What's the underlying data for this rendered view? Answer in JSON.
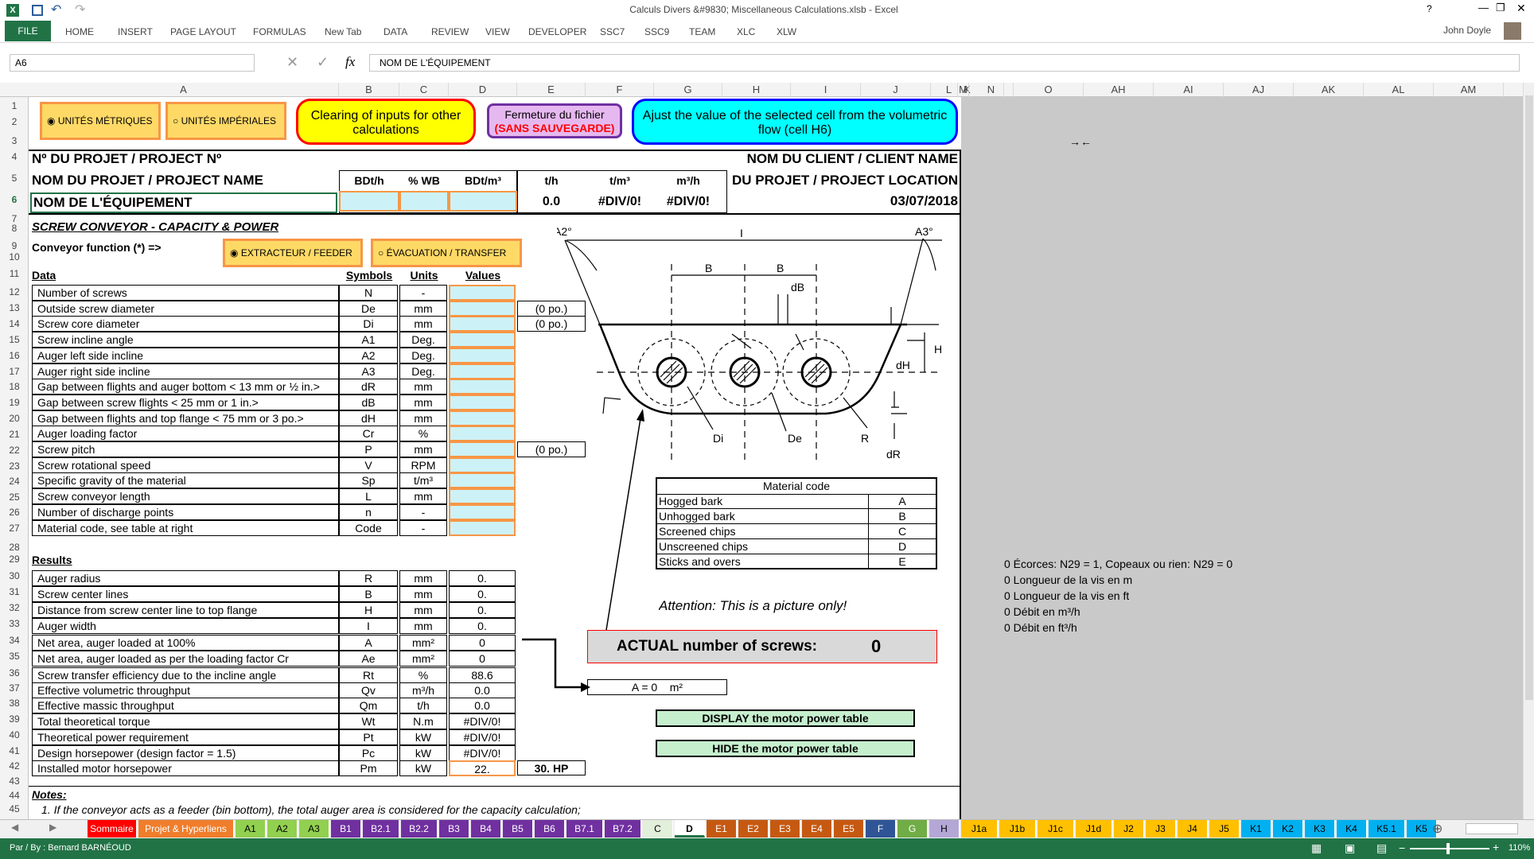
{
  "window": {
    "title": "Calculs Divers &#9830; Miscellaneous Calculations.xlsb - Excel",
    "user": "John Doyle",
    "help": "?"
  },
  "ribbon": {
    "file": "FILE",
    "tabs": [
      "HOME",
      "INSERT",
      "PAGE LAYOUT",
      "FORMULAS",
      "New Tab",
      "DATA",
      "REVIEW",
      "VIEW",
      "DEVELOPER",
      "SSC7",
      "SSC9",
      "TEAM",
      "XLC",
      "XLW"
    ]
  },
  "formula_bar": {
    "name_box": "A6",
    "content": "NOM DE L'ÉQUIPEMENT",
    "fx": "fx"
  },
  "columns": [
    "A",
    "B",
    "C",
    "D",
    "E",
    "F",
    "G",
    "H",
    "I",
    "J",
    "K",
    "L",
    "M",
    "N",
    "O",
    "AH",
    "AI",
    "AJ",
    "AK",
    "AL",
    "AM"
  ],
  "rows": [
    "1",
    "2",
    "3",
    "4",
    "5",
    "6",
    "7",
    "8",
    "9",
    "10",
    "11",
    "12",
    "13",
    "14",
    "15",
    "16",
    "17",
    "18",
    "19",
    "20",
    "21",
    "22",
    "23",
    "24",
    "25",
    "26",
    "27",
    "28",
    "29",
    "30",
    "31",
    "32",
    "33",
    "34",
    "35",
    "36",
    "37",
    "38",
    "39",
    "40",
    "41",
    "42",
    "43",
    "44",
    "45"
  ],
  "buttons": {
    "metric": "UNITÉS MÉTRIQUES",
    "imperial": "UNITÉS IMPÉRIALES",
    "clearing": "Clearing of inputs for other calculations",
    "closing1": "Fermeture du fichier",
    "closing2": "(SANS SAUVEGARDE)",
    "adjust": "Ajust the value of the selected cell from the volumetric flow (cell H6)",
    "extractor": "EXTRACTEUR / FEEDER",
    "evacuation": "ÉVACUATION / TRANSFER",
    "display": "DISPLAY the motor power table",
    "hide": "HIDE the motor power table"
  },
  "header": {
    "project_no": "Nº DU PROJET / PROJECT Nº",
    "project_name": "NOM DU PROJET / PROJECT NAME",
    "equipment": "NOM DE L'ÉQUIPEMENT",
    "client": "NOM DU CLIENT / CLIENT NAME",
    "location": "DU PROJET / PROJECT LOCATION",
    "date": "03/07/2018",
    "arrows": "→←",
    "cols": [
      "BDt/h",
      "% WB",
      "BDt/m³",
      "t/h",
      "t/m³",
      "m³/h"
    ],
    "vals": [
      "0.0",
      "#DIV/0!",
      "#DIV/0!"
    ]
  },
  "section": {
    "title": "SCREW CONVEYOR - CAPACITY & POWER",
    "function": "Conveyor function (*) =>",
    "data": "Data",
    "symbols": "Symbols",
    "units": "Units",
    "values": "Values",
    "results": "Results",
    "notes": "Notes:",
    "note1": "1. If the conveyor acts as a feeder (bin bottom), the total auger area is considered for the capacity calculation;"
  },
  "data_rows": [
    {
      "label": "Number of screws",
      "sym": "N",
      "unit": "-",
      "val": "",
      "extra": ""
    },
    {
      "label": "Outside screw diameter",
      "sym": "De",
      "unit": "mm",
      "val": "",
      "extra": "(0 po.)"
    },
    {
      "label": "Screw core diameter",
      "sym": "Di",
      "unit": "mm",
      "val": "",
      "extra": "(0 po.)"
    },
    {
      "label": "Screw incline angle",
      "sym": "A1",
      "unit": "Deg.",
      "val": "",
      "extra": ""
    },
    {
      "label": "Auger left side incline",
      "sym": "A2",
      "unit": "Deg.",
      "val": "",
      "extra": ""
    },
    {
      "label": "Auger right side incline",
      "sym": "A3",
      "unit": "Deg.",
      "val": "",
      "extra": ""
    },
    {
      "label": "Gap between flights and auger bottom < 13 mm or ½ in.>",
      "sym": "dR",
      "unit": "mm",
      "val": "",
      "extra": ""
    },
    {
      "label": "Gap between screw flights < 25 mm or 1 in.>",
      "sym": "dB",
      "unit": "mm",
      "val": "",
      "extra": ""
    },
    {
      "label": "Gap between flights and top flange < 75 mm or 3 po.>",
      "sym": "dH",
      "unit": "mm",
      "val": "",
      "extra": ""
    },
    {
      "label": "Auger loading factor",
      "sym": "Cr",
      "unit": "%",
      "val": "",
      "extra": ""
    },
    {
      "label": "Screw pitch",
      "sym": "P",
      "unit": "mm",
      "val": "",
      "extra": "(0 po.)"
    },
    {
      "label": "Screw rotational speed",
      "sym": "V",
      "unit": "RPM",
      "val": "",
      "extra": ""
    },
    {
      "label": "Specific gravity of the material",
      "sym": "Sp",
      "unit": "t/m³",
      "val": "",
      "extra": ""
    },
    {
      "label": "Screw conveyor length",
      "sym": "L",
      "unit": "mm",
      "val": "",
      "extra": ""
    },
    {
      "label": "Number of discharge points",
      "sym": "n",
      "unit": "-",
      "val": "",
      "extra": ""
    },
    {
      "label": "Material code, see table at right",
      "sym": "Code",
      "unit": "-",
      "val": "",
      "extra": ""
    }
  ],
  "result_rows": [
    {
      "label": "Auger radius",
      "sym": "R",
      "unit": "mm",
      "val": "0."
    },
    {
      "label": "Screw center lines",
      "sym": "B",
      "unit": "mm",
      "val": "0."
    },
    {
      "label": "Distance from screw center line to top flange",
      "sym": "H",
      "unit": "mm",
      "val": "0."
    },
    {
      "label": "Auger width",
      "sym": "I",
      "unit": "mm",
      "val": "0."
    },
    {
      "label": "Net area, auger loaded at 100%",
      "sym": "A",
      "unit": "mm²",
      "val": "0"
    },
    {
      "label": "Net area, auger loaded as per the loading factor Cr",
      "sym": "Ae",
      "unit": "mm²",
      "val": "0"
    },
    {
      "label": "Screw transfer efficiency due to the incline angle",
      "sym": "Rt",
      "unit": "%",
      "val": "88.6"
    },
    {
      "label": "Effective volumetric throughput",
      "sym": "Qv",
      "unit": "m³/h",
      "val": "0.0"
    },
    {
      "label": "Effective massic throughput",
      "sym": "Qm",
      "unit": "t/h",
      "val": "0.0"
    },
    {
      "label": "Total theoretical torque",
      "sym": "Wt",
      "unit": "N.m",
      "val": "#DIV/0!"
    },
    {
      "label": "Theoretical power requirement",
      "sym": "Pt",
      "unit": "kW",
      "val": "#DIV/0!"
    },
    {
      "label": "Design horsepower (design factor = 1.5)",
      "sym": "Pc",
      "unit": "kW",
      "val": "#DIV/0!"
    },
    {
      "label": "Installed motor horsepower",
      "sym": "Pm",
      "unit": "kW",
      "val": "22."
    }
  ],
  "hp": "30. HP",
  "material": {
    "title": "Material code",
    "rows": [
      [
        "Hogged bark",
        "A"
      ],
      [
        "Unhogged bark",
        "B"
      ],
      [
        "Screened chips",
        "C"
      ],
      [
        "Unscreened chips",
        "D"
      ],
      [
        "Sticks and overs",
        "E"
      ]
    ]
  },
  "diagram": {
    "A2": "A2°",
    "A3": "A3°",
    "I": "I",
    "B1": "B",
    "B2": "B",
    "dB": "dB",
    "H": "H",
    "dH": "dH",
    "Di": "Di",
    "De": "De",
    "R": "R",
    "dR": "dR"
  },
  "attention": "Attention: This is a picture only!",
  "actual": {
    "label": "ACTUAL number of screws:",
    "value": "0"
  },
  "area": "A = 0    m²",
  "side_notes": [
    "0 Écorces: N29 = 1, Copeaux ou rien: N29 = 0",
    "0 Longueur de la vis en m",
    "0 Longueur de la vis en ft",
    "0 Débit en m³/h",
    "0 Débit en ft³/h"
  ],
  "sheets": [
    {
      "n": "Sommaire",
      "c": "#ff0000",
      "t": "#fff"
    },
    {
      "n": "Projet & Hyperliens",
      "c": "#f07d2b",
      "t": "#fff"
    },
    {
      "n": "A1",
      "c": "#92d050",
      "t": "#000"
    },
    {
      "n": "A2",
      "c": "#92d050",
      "t": "#000"
    },
    {
      "n": "A3",
      "c": "#92d050",
      "t": "#000"
    },
    {
      "n": "B1",
      "c": "#7030a0",
      "t": "#fff"
    },
    {
      "n": "B2.1",
      "c": "#7030a0",
      "t": "#fff"
    },
    {
      "n": "B2.2",
      "c": "#7030a0",
      "t": "#fff"
    },
    {
      "n": "B3",
      "c": "#7030a0",
      "t": "#fff"
    },
    {
      "n": "B4",
      "c": "#7030a0",
      "t": "#fff"
    },
    {
      "n": "B5",
      "c": "#7030a0",
      "t": "#fff"
    },
    {
      "n": "B6",
      "c": "#7030a0",
      "t": "#fff"
    },
    {
      "n": "B7.1",
      "c": "#7030a0",
      "t": "#fff"
    },
    {
      "n": "B7.2",
      "c": "#7030a0",
      "t": "#fff"
    },
    {
      "n": "C",
      "c": "#e2efda",
      "t": "#000"
    },
    {
      "n": "D",
      "c": "#ffffff",
      "t": "#000"
    },
    {
      "n": "E1",
      "c": "#c65911",
      "t": "#fff"
    },
    {
      "n": "E2",
      "c": "#c65911",
      "t": "#fff"
    },
    {
      "n": "E3",
      "c": "#c65911",
      "t": "#fff"
    },
    {
      "n": "E4",
      "c": "#c65911",
      "t": "#fff"
    },
    {
      "n": "E5",
      "c": "#c65911",
      "t": "#fff"
    },
    {
      "n": "F",
      "c": "#2f5597",
      "t": "#fff"
    },
    {
      "n": "G",
      "c": "#70ad47",
      "t": "#fff"
    },
    {
      "n": "H",
      "c": "#b4a7d6",
      "t": "#000"
    },
    {
      "n": "J1a",
      "c": "#ffc000",
      "t": "#000"
    },
    {
      "n": "J1b",
      "c": "#ffc000",
      "t": "#000"
    },
    {
      "n": "J1c",
      "c": "#ffc000",
      "t": "#000"
    },
    {
      "n": "J1d",
      "c": "#ffc000",
      "t": "#000"
    },
    {
      "n": "J2",
      "c": "#ffc000",
      "t": "#000"
    },
    {
      "n": "J3",
      "c": "#ffc000",
      "t": "#000"
    },
    {
      "n": "J4",
      "c": "#ffc000",
      "t": "#000"
    },
    {
      "n": "J5",
      "c": "#ffc000",
      "t": "#000"
    },
    {
      "n": "K1",
      "c": "#00b0f0",
      "t": "#000"
    },
    {
      "n": "K2",
      "c": "#00b0f0",
      "t": "#000"
    },
    {
      "n": "K3",
      "c": "#00b0f0",
      "t": "#000"
    },
    {
      "n": "K4",
      "c": "#00b0f0",
      "t": "#000"
    },
    {
      "n": "K5.1",
      "c": "#00b0f0",
      "t": "#000"
    },
    {
      "n": "K5",
      "c": "#00b0f0",
      "t": "#000"
    }
  ],
  "status": {
    "author": "Par / By : Bernard BARNÉOUD",
    "zoom": "110%"
  }
}
